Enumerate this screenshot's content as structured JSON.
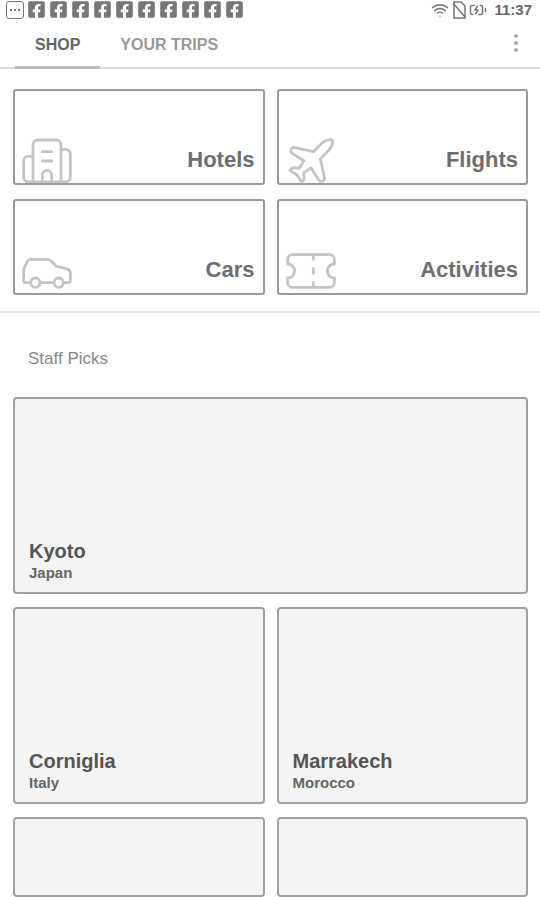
{
  "status_bar": {
    "notification_count": 10,
    "time": "11:37"
  },
  "tabs": [
    {
      "label": "SHOP",
      "selected": true
    },
    {
      "label": "YOUR TRIPS",
      "selected": false
    }
  ],
  "categories": [
    {
      "label": "Hotels",
      "kind": "hotel"
    },
    {
      "label": "Flights",
      "kind": "flight"
    },
    {
      "label": "Cars",
      "kind": "car"
    },
    {
      "label": "Activities",
      "kind": "activity"
    }
  ],
  "staff_picks": {
    "title": "Staff Picks",
    "destinations": [
      {
        "kind": "featured",
        "city": "Kyoto",
        "country": "Japan"
      },
      {
        "kind": "standard",
        "city": "Corniglia",
        "country": "Italy"
      },
      {
        "kind": "standard",
        "city": "Marrakech",
        "country": "Morocco"
      },
      {
        "kind": "cut"
      },
      {
        "kind": "cut"
      }
    ]
  }
}
